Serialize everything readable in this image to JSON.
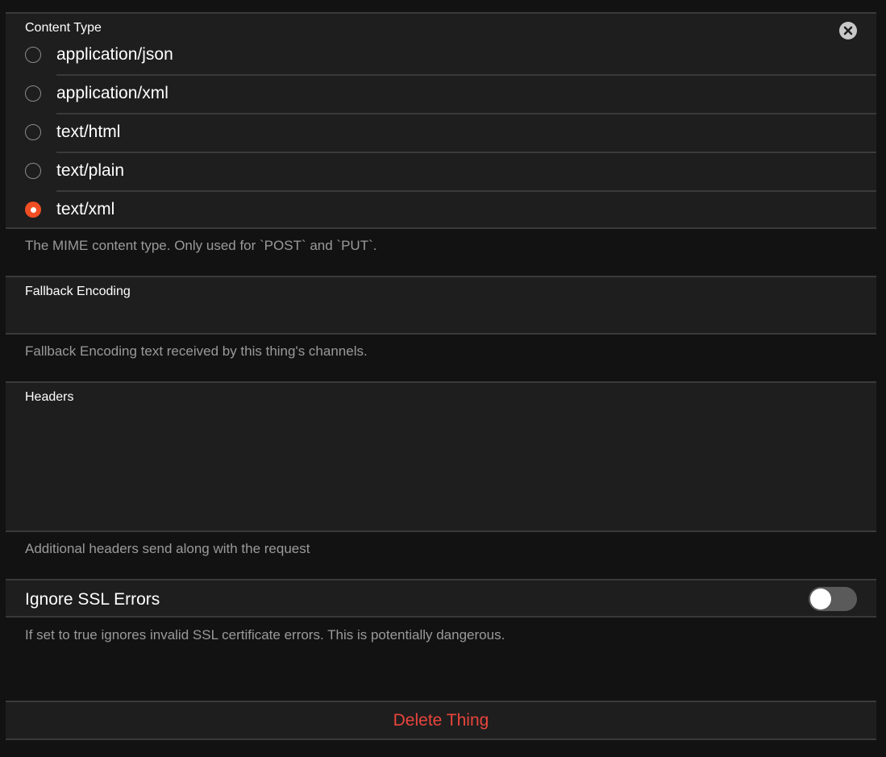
{
  "content_type": {
    "label": "Content Type",
    "options": [
      {
        "label": "application/json",
        "checked": false
      },
      {
        "label": "application/xml",
        "checked": false
      },
      {
        "label": "text/html",
        "checked": false
      },
      {
        "label": "text/plain",
        "checked": false
      },
      {
        "label": "text/xml",
        "checked": true
      }
    ],
    "hint": "The MIME content type. Only used for `POST` and `PUT`."
  },
  "fallback_encoding": {
    "label": "Fallback Encoding",
    "value": "",
    "hint": "Fallback Encoding text received by this thing's channels."
  },
  "headers": {
    "label": "Headers",
    "value": "",
    "hint": "Additional headers send along with the request"
  },
  "ignore_ssl": {
    "label": "Ignore SSL Errors",
    "enabled": false,
    "hint": "If set to true ignores invalid SSL certificate errors. This is potentially dangerous."
  },
  "delete_button": {
    "label": "Delete Thing"
  },
  "colors": {
    "accent": "#f04e23",
    "danger": "#e8453c",
    "background": "#121212",
    "panel": "#1e1e1e"
  }
}
